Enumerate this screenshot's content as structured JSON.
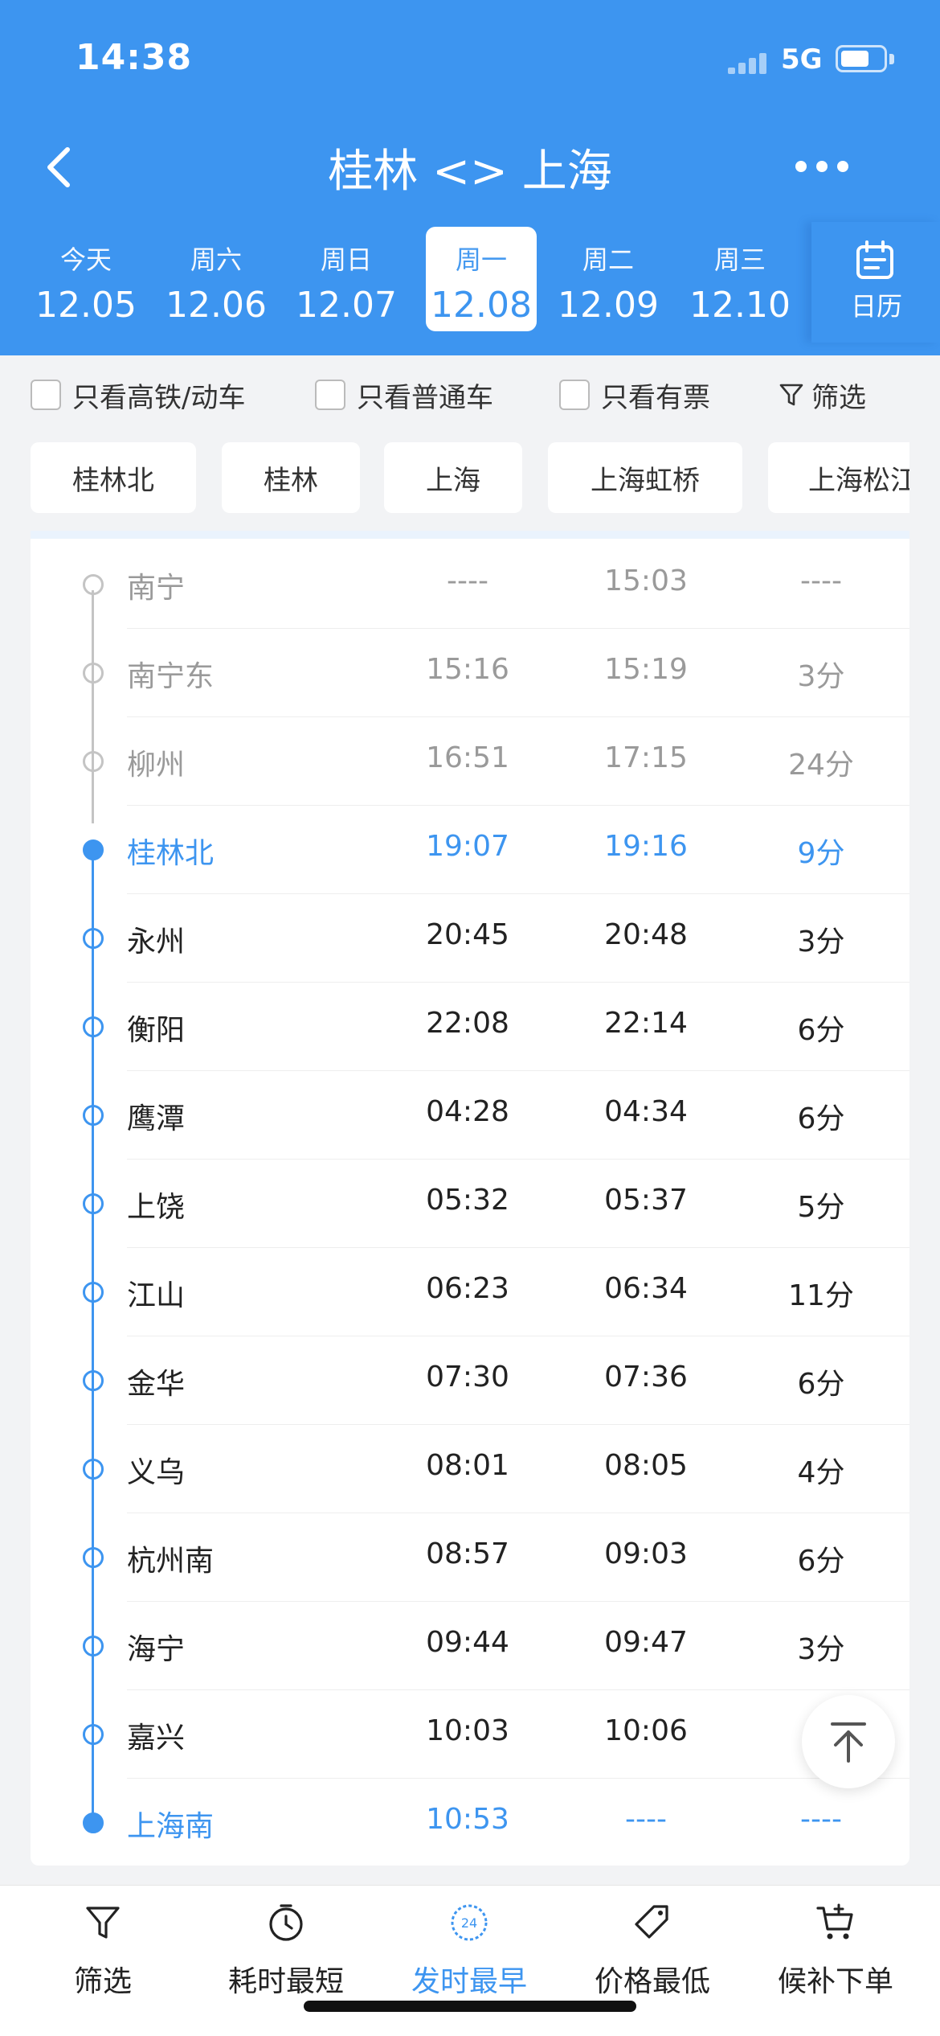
{
  "status_bar": {
    "time": "14:38",
    "network": "5G"
  },
  "nav": {
    "title": "桂林 <> 上海"
  },
  "dates": [
    {
      "weekday": "今天",
      "date": "12.05",
      "active": false
    },
    {
      "weekday": "周六",
      "date": "12.06",
      "active": false
    },
    {
      "weekday": "周日",
      "date": "12.07",
      "active": false
    },
    {
      "weekday": "周一",
      "date": "12.08",
      "active": true
    },
    {
      "weekday": "周二",
      "date": "12.09",
      "active": false
    },
    {
      "weekday": "周三",
      "date": "12.10",
      "active": false
    }
  ],
  "calendar_label": "日历",
  "filters": {
    "high_speed_only": "只看高铁/动车",
    "normal_only": "只看普通车",
    "available_only": "只看有票",
    "filter_label": "筛选"
  },
  "stations": [
    "桂林北",
    "桂林",
    "上海",
    "上海虹桥",
    "上海松江"
  ],
  "stops": [
    {
      "name": "南宁",
      "arrive": "----",
      "depart": "15:03",
      "stay": "----",
      "state": "passed"
    },
    {
      "name": "南宁东",
      "arrive": "15:16",
      "depart": "15:19",
      "stay": "3分",
      "state": "passed"
    },
    {
      "name": "柳州",
      "arrive": "16:51",
      "depart": "17:15",
      "stay": "24分",
      "state": "passed"
    },
    {
      "name": "桂林北",
      "arrive": "19:07",
      "depart": "19:16",
      "stay": "9分",
      "state": "key"
    },
    {
      "name": "永州",
      "arrive": "20:45",
      "depart": "20:48",
      "stay": "3分",
      "state": "normal"
    },
    {
      "name": "衡阳",
      "arrive": "22:08",
      "depart": "22:14",
      "stay": "6分",
      "state": "normal"
    },
    {
      "name": "鹰潭",
      "arrive": "04:28",
      "depart": "04:34",
      "stay": "6分",
      "state": "normal"
    },
    {
      "name": "上饶",
      "arrive": "05:32",
      "depart": "05:37",
      "stay": "5分",
      "state": "normal"
    },
    {
      "name": "江山",
      "arrive": "06:23",
      "depart": "06:34",
      "stay": "11分",
      "state": "normal"
    },
    {
      "name": "金华",
      "arrive": "07:30",
      "depart": "07:36",
      "stay": "6分",
      "state": "normal"
    },
    {
      "name": "义乌",
      "arrive": "08:01",
      "depart": "08:05",
      "stay": "4分",
      "state": "normal"
    },
    {
      "name": "杭州南",
      "arrive": "08:57",
      "depart": "09:03",
      "stay": "6分",
      "state": "normal"
    },
    {
      "name": "海宁",
      "arrive": "09:44",
      "depart": "09:47",
      "stay": "3分",
      "state": "normal"
    },
    {
      "name": "嘉兴",
      "arrive": "10:03",
      "depart": "10:06",
      "stay": "",
      "state": "normal"
    },
    {
      "name": "上海南",
      "arrive": "10:53",
      "depart": "----",
      "stay": "----",
      "state": "key"
    }
  ],
  "tabs": [
    {
      "label": "筛选",
      "icon": "funnel-icon",
      "active": false
    },
    {
      "label": "耗时最短",
      "icon": "timer-icon",
      "active": false
    },
    {
      "label": "发时最早",
      "icon": "clock-24-icon",
      "active": true,
      "badge": "24"
    },
    {
      "label": "价格最低",
      "icon": "price-tag-icon",
      "active": false
    },
    {
      "label": "候补下单",
      "icon": "cart-icon",
      "active": false
    }
  ],
  "colors": {
    "primary": "#3d95f0",
    "passed": "#9a9a9a",
    "text": "#222222",
    "background": "#f2f3f5"
  }
}
